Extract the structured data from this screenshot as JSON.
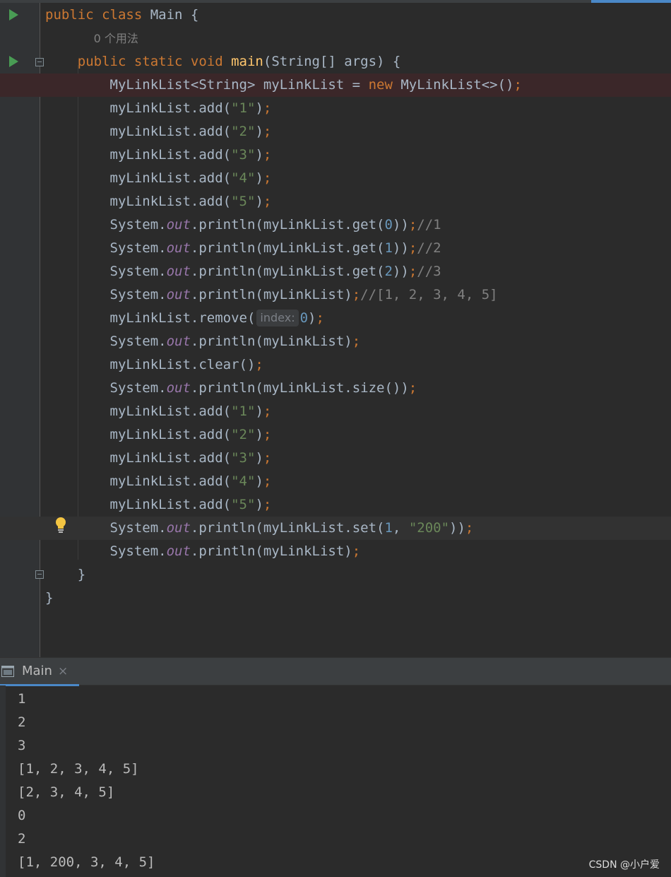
{
  "editor": {
    "usage_hint": "0 个用法",
    "param_hint": "index:"
  },
  "run": {
    "tab_label": "Main",
    "close_glyph": "×",
    "output": [
      "1",
      "2",
      "3",
      "[1, 2, 3, 4, 5]",
      "[2, 3, 4, 5]",
      "0",
      "2",
      "[1, 200, 3, 4, 5]"
    ]
  },
  "watermark": "CSDN @小户爱",
  "colors": {
    "background": "#2b2b2b",
    "keyword": "#cc7832",
    "string": "#6a8759",
    "number": "#6897bb",
    "method_decl": "#ffc66d",
    "static_field": "#9876aa",
    "breakpoint": "#db5c5c",
    "run_icon": "#499c54",
    "accent": "#4a88c7"
  }
}
